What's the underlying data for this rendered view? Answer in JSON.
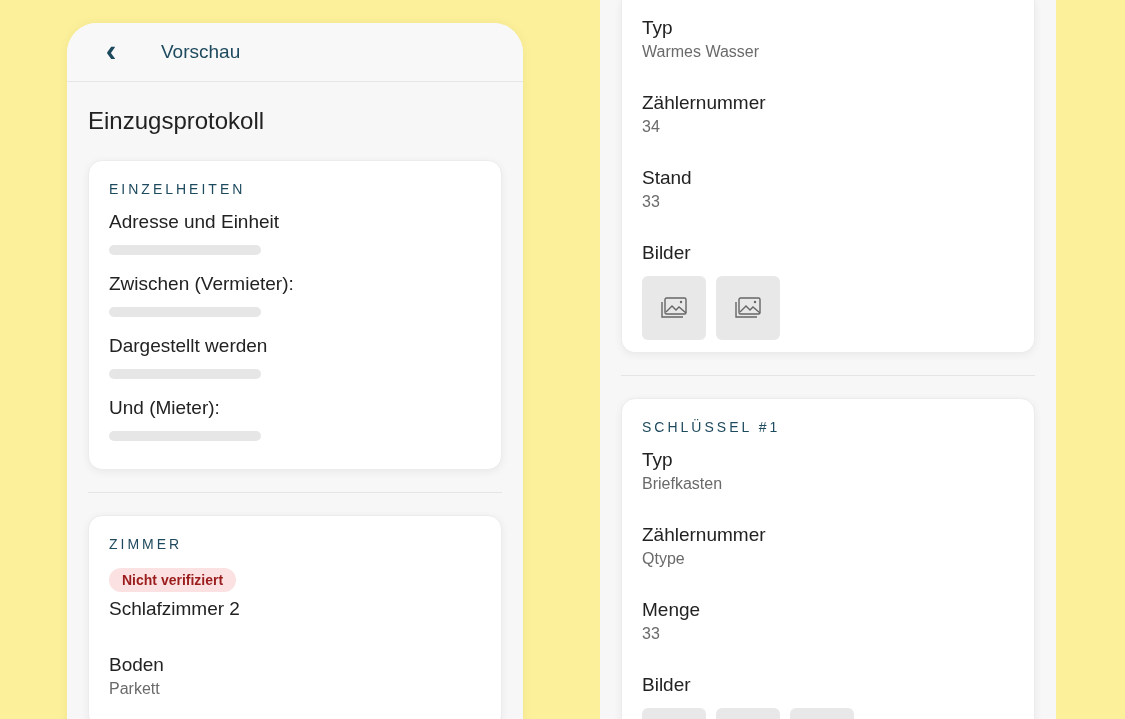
{
  "left_screen": {
    "header": {
      "back_icon": "‹",
      "title": "Vorschau"
    },
    "page_title": "Einzugsprotokoll",
    "sections": [
      {
        "heading": "EINZELHEITEN",
        "fields": [
          {
            "kind": "skeleton",
            "label": "Adresse und Einheit"
          },
          {
            "kind": "skeleton",
            "label": "Zwischen (Vermieter):"
          },
          {
            "kind": "skeleton",
            "label": "Dargestellt werden"
          },
          {
            "kind": "skeleton",
            "label": "Und (Mieter):"
          }
        ]
      },
      {
        "heading": "ZIMMER",
        "badge": "Nicht verifiziert",
        "name": "Schlafzimmer 2",
        "fields": [
          {
            "kind": "text",
            "label": "Boden",
            "value": "Parkett"
          }
        ]
      }
    ]
  },
  "right_screen": {
    "sections": [
      {
        "fields": [
          {
            "kind": "text",
            "label": "Typ",
            "value": "Warmes Wasser"
          },
          {
            "kind": "text",
            "label": "Zählernummer",
            "value": "34"
          },
          {
            "kind": "text",
            "label": "Stand",
            "value": "33"
          },
          {
            "kind": "images",
            "label": "Bilder",
            "images": [
              {
                "kind": "placeholder"
              },
              {
                "kind": "placeholder"
              }
            ]
          }
        ]
      },
      {
        "heading": "SCHLÜSSEL #1",
        "fields": [
          {
            "kind": "text",
            "label": "Typ",
            "value": "Briefkasten"
          },
          {
            "kind": "text",
            "label": "Zählernummer",
            "value": "Qtype"
          },
          {
            "kind": "text",
            "label": "Menge",
            "value": "33"
          },
          {
            "kind": "images",
            "label": "Bilder",
            "images": [
              {
                "kind": "blank"
              },
              {
                "kind": "blank"
              },
              {
                "kind": "blank"
              }
            ]
          }
        ]
      }
    ]
  }
}
